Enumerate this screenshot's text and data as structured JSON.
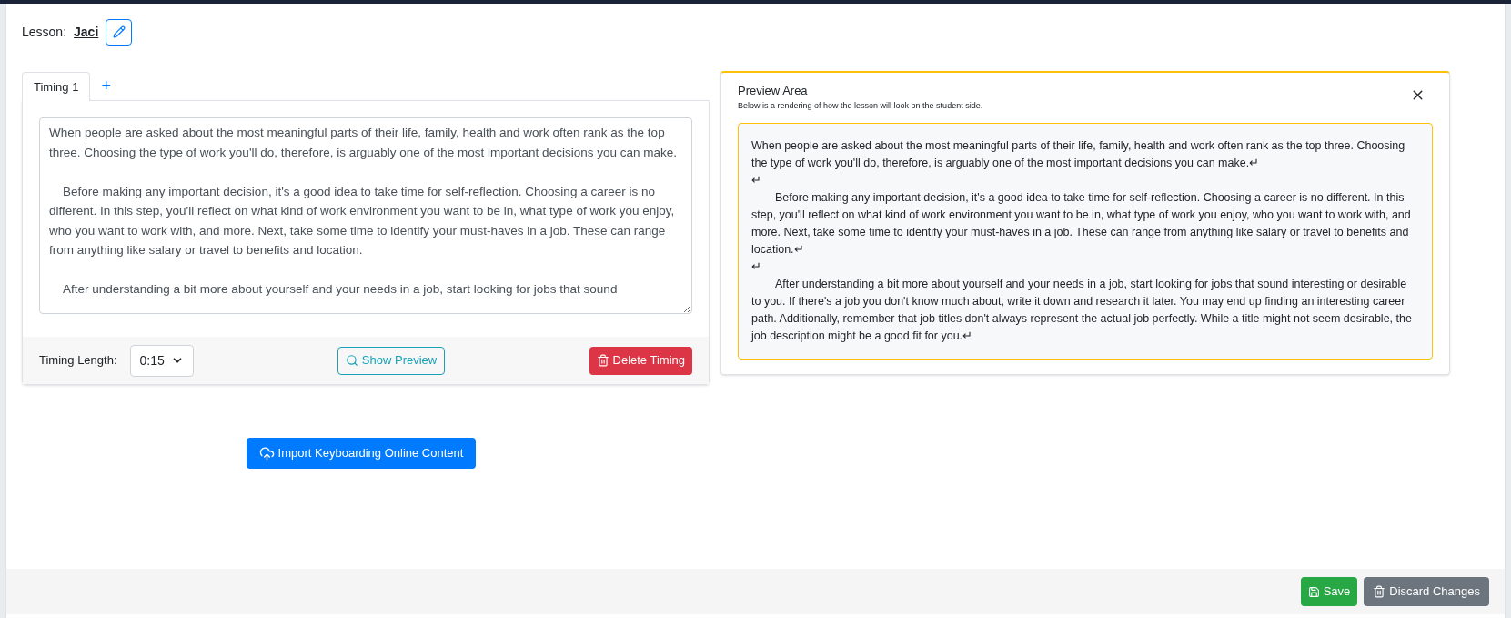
{
  "lesson": {
    "label": "Lesson:",
    "name": "Jaci"
  },
  "tabs": [
    {
      "label": "Timing 1",
      "selected": true
    }
  ],
  "add_tab": "+",
  "editor": {
    "value": "When people are asked about the most meaningful parts of their life, family, health and work often rank as the top three. Choosing the type of work you'll do, therefore, is arguably one of the most important decisions you can make.\n\n\tBefore making any important decision, it's a good idea to take time for self-reflection. Choosing a career is no different. In this step, you'll reflect on what kind of work environment you want to be in, what type of work you enjoy, who you want to work with, and more. Next, take some time to identify your must-haves in a job. These can range from anything like salary or travel to benefits and location.\n\n\tAfter understanding a bit more about yourself and your needs in a job, start looking for jobs that sound"
  },
  "timing_length": {
    "label": "Timing Length:",
    "value": "0:15"
  },
  "show_preview": "Show Preview",
  "delete_timing": "Delete Timing",
  "import_button": "Import Keyboarding Online Content",
  "preview": {
    "title": "Preview Area",
    "subtitle": "Below is a rendering of how the lesson will look on the student side.",
    "lines": [
      {
        "text": "When people are asked about the most meaningful parts of their life, family, health and work often rank as the top three. Choosing the type of work you'll do, therefore, is arguably one of the most important decisions you can make.↵",
        "indented": false
      },
      {
        "text": "↵",
        "indented": false
      },
      {
        "text": "Before making any important decision, it's a good idea to take time for self-reflection. Choosing a career is no different. In this step, you'll reflect on what kind of work environment you want to be in, what type of work you enjoy, who you want to work with, and more. Next, take some time to identify your must-haves in a job. These can range from anything like salary or travel to benefits and location.↵",
        "indented": true
      },
      {
        "text": "↵",
        "indented": false
      },
      {
        "text": "After understanding a bit more about yourself and your needs in a job, start looking for jobs that sound interesting or desirable to you. If there's a job you don't know much about, write it down and research it later. You may end up finding an interesting career path. Additionally, remember that job titles don't always represent the actual job perfectly. While a title might not seem desirable, the job description might be a good fit for you.↵",
        "indented": true
      }
    ]
  },
  "footer": {
    "save": "Save",
    "discard": "Discard Changes"
  }
}
